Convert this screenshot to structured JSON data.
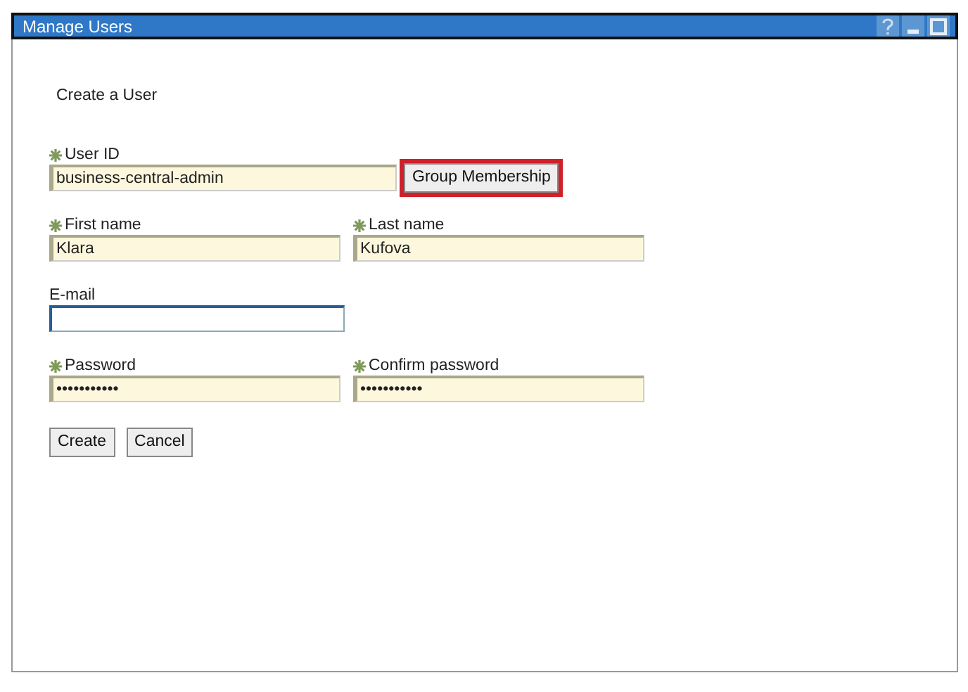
{
  "window": {
    "title": "Manage Users"
  },
  "heading": "Create a User",
  "rows": [
    {
      "fields": [
        {
          "label": "User ID",
          "required": true,
          "value": "business-central-admin",
          "focused": false
        }
      ],
      "button": {
        "label": "Group Membership",
        "highlighted": true
      }
    },
    {
      "fields": [
        {
          "label": "First name",
          "required": true,
          "value": "Klara",
          "focused": false
        },
        {
          "label": "Last name",
          "required": true,
          "value": "Kufova",
          "focused": false
        }
      ]
    },
    {
      "fields": [
        {
          "label": "E-mail",
          "required": false,
          "focused": true
        }
      ]
    },
    {
      "fields": [
        {
          "label": "Password",
          "required": true,
          "value": "•••••••••••",
          "focused": false
        },
        {
          "label": "Confirm password",
          "required": true,
          "value": "•••••••••••",
          "focused": false
        }
      ]
    }
  ],
  "buttons": [
    "Create",
    "Cancel"
  ]
}
